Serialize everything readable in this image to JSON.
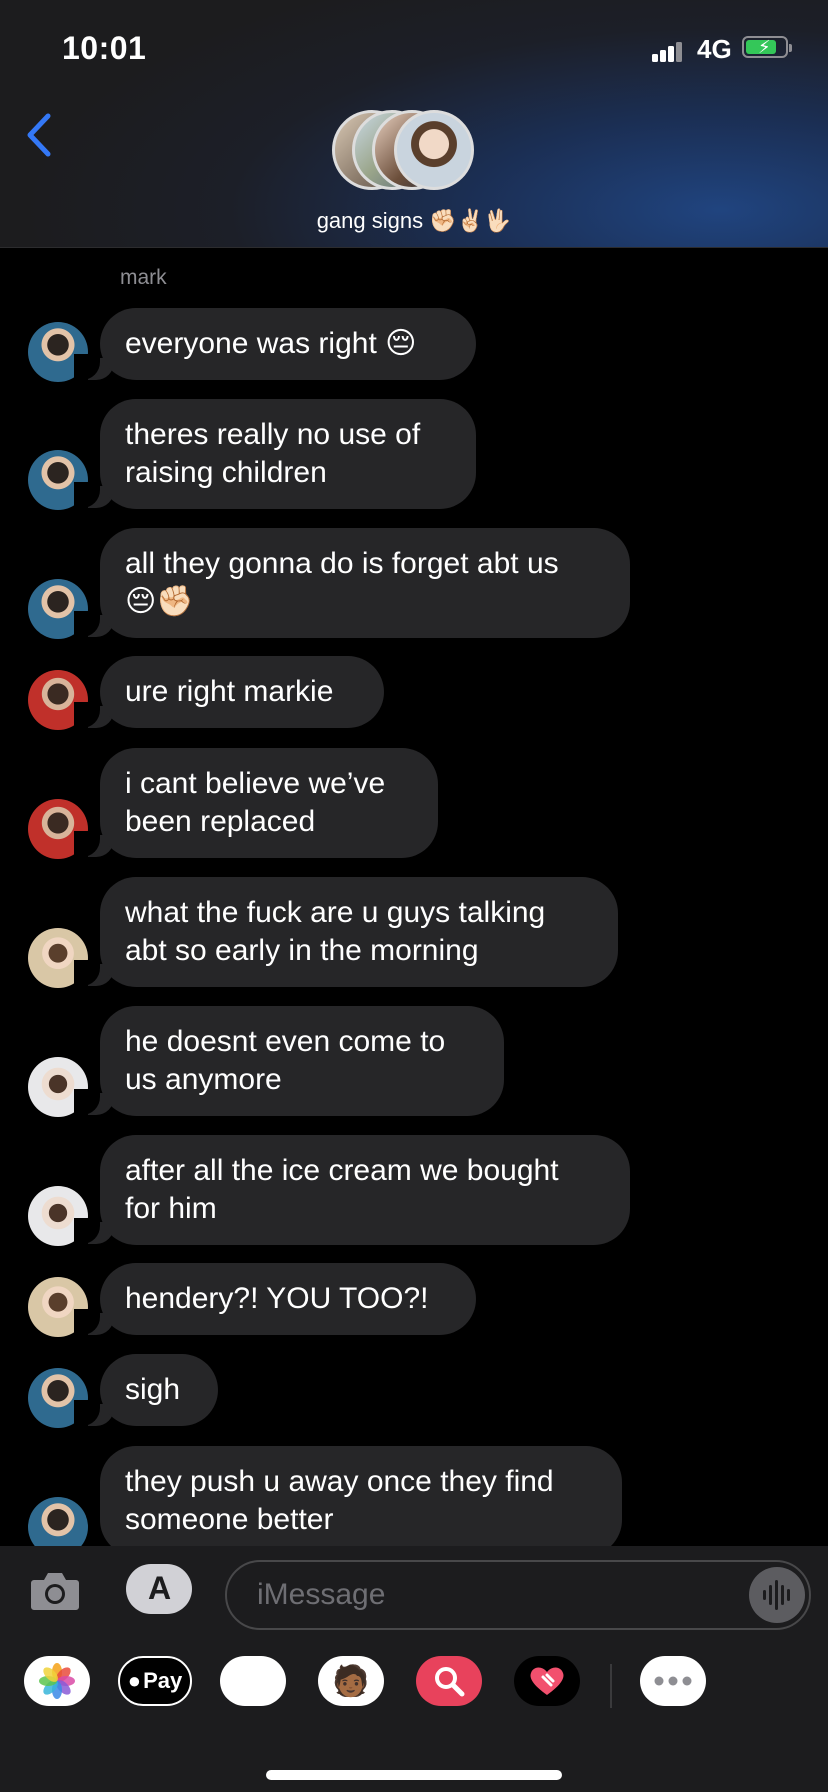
{
  "status": {
    "time": "10:01",
    "network": "4G"
  },
  "header": {
    "group_name": "gang signs",
    "group_emojis": "✊🏻✌🏻🖖🏻"
  },
  "conversation": {
    "sender_label": "mark",
    "messages": [
      {
        "text": "everyone was right 😔"
      },
      {
        "text": "theres really no use of\nraising children"
      },
      {
        "text": "all they gonna do is forget abt us\n😔✊🏻"
      },
      {
        "text": "ure right markie"
      },
      {
        "text": "i cant believe we’ve\nbeen replaced"
      },
      {
        "text": "what the fuck are u guys talking\nabt so early in the morning"
      },
      {
        "text": "he doesnt even come to\nus anymore"
      },
      {
        "text": "after all the ice cream we bought\nfor him"
      },
      {
        "text": "hendery?! YOU TOO?!"
      },
      {
        "text": "sigh"
      },
      {
        "text": "they push u away once they find\nsomeone better"
      }
    ]
  },
  "compose": {
    "placeholder": "iMessage"
  },
  "app_strip": {
    "apple_pay_label": "Pay",
    "icons": [
      "photos-icon",
      "apple-pay-icon",
      "animoji-icon",
      "memoji-icon",
      "image-search-icon",
      "digital-touch-icon",
      "more-apps-icon"
    ]
  },
  "colors": {
    "accent": "#3478f6",
    "bubble": "#262628",
    "background": "#000000",
    "placeholder": "#6e6e73",
    "sender_label": "#8e8e93"
  }
}
